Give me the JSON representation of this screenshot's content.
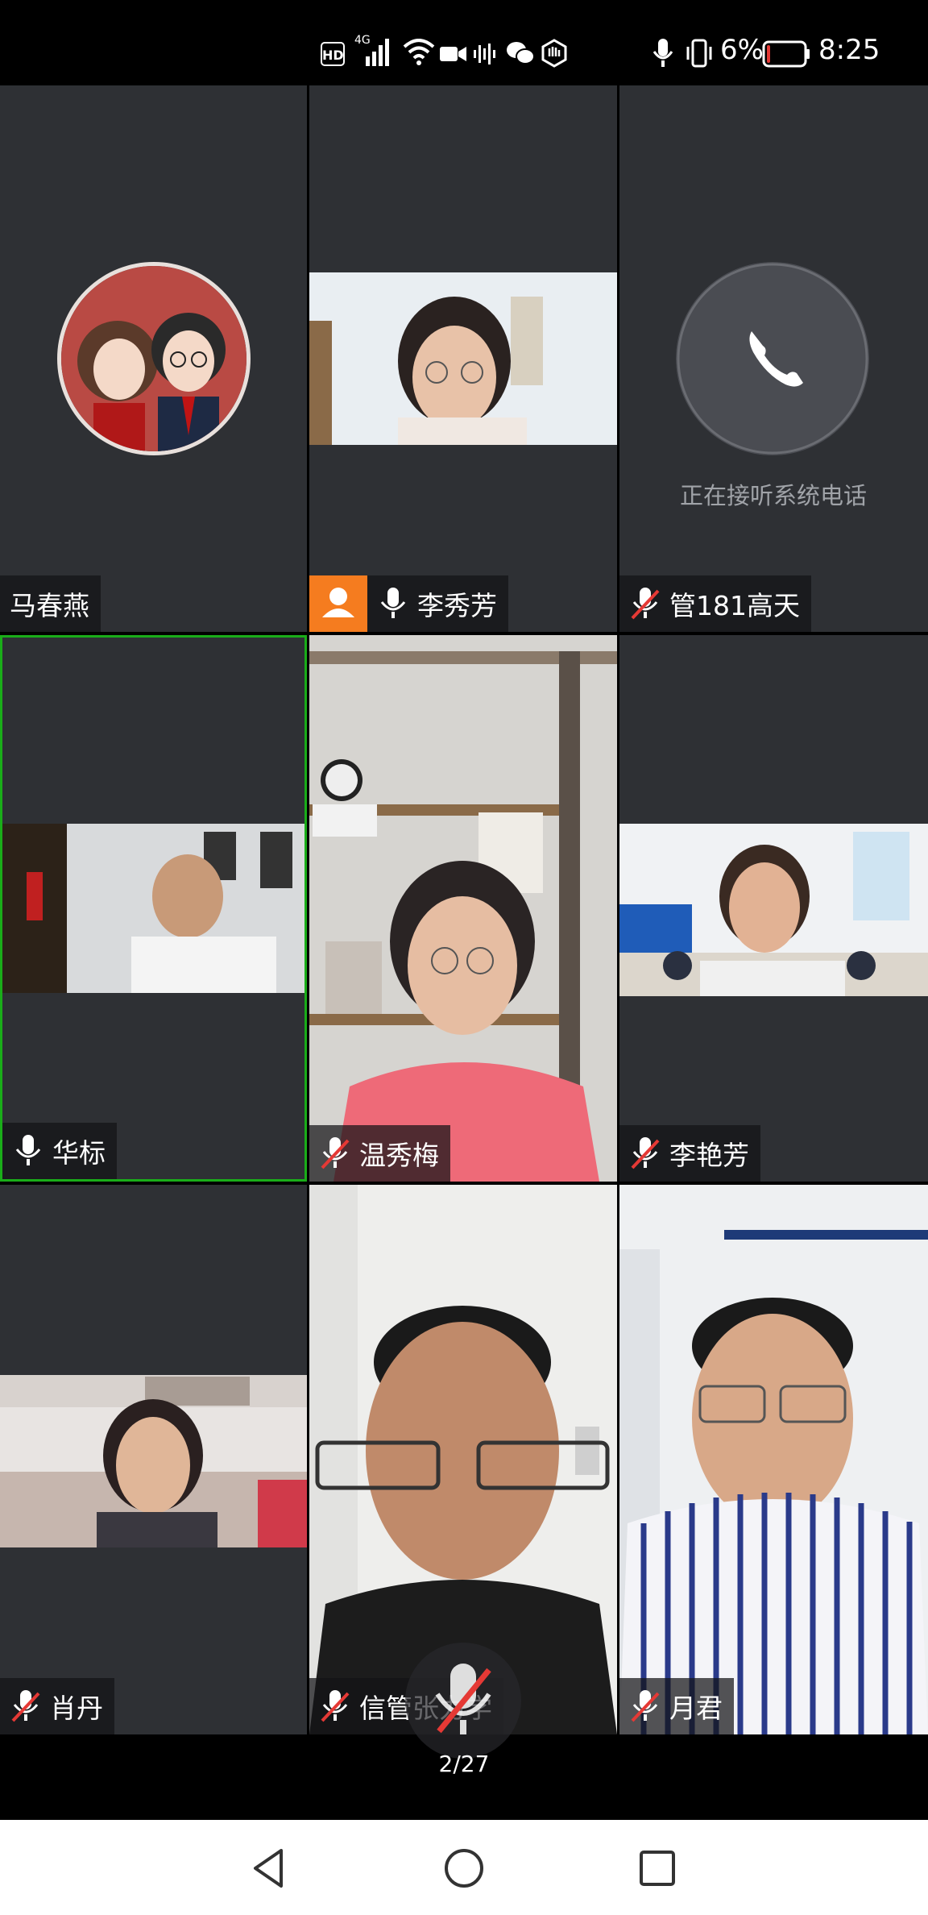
{
  "status_bar": {
    "hd": "HD",
    "signal": "4G",
    "battery_pct": "6%",
    "battery_level": 0.06,
    "time": "8:25",
    "icons": [
      "hd-icon",
      "signal-icon",
      "wifi-icon",
      "video-icon",
      "audio-icon",
      "wechat-icon",
      "hand-icon",
      "mic-icon",
      "vibrate-icon",
      "battery-icon"
    ]
  },
  "participants": [
    {
      "name": "马春燕",
      "mic": "none",
      "kind": "avatar"
    },
    {
      "name": "李秀芳",
      "mic": "on",
      "kind": "video",
      "host": true
    },
    {
      "name": "管181高天",
      "mic": "muted",
      "kind": "call",
      "status_text": "正在接听系统电话"
    },
    {
      "name": "华标",
      "mic": "on",
      "kind": "video",
      "speaking": true
    },
    {
      "name": "温秀梅",
      "mic": "muted",
      "kind": "video"
    },
    {
      "name": "李艳芳",
      "mic": "muted",
      "kind": "video"
    },
    {
      "name": "肖丹",
      "mic": "muted",
      "kind": "video"
    },
    {
      "name": "信管张力学",
      "mic": "muted",
      "kind": "video"
    },
    {
      "name": "月君",
      "mic": "muted",
      "kind": "video"
    }
  ],
  "page_indicator": "2/27",
  "colors": {
    "tile_bg": "#2e3034",
    "speaking_border": "#1aad19",
    "host_badge": "#f57c1f",
    "muted_slash": "#e53935",
    "battery_low": "#e53935"
  },
  "nav": {
    "back": "back-icon",
    "home": "home-icon",
    "recents": "recents-icon"
  }
}
